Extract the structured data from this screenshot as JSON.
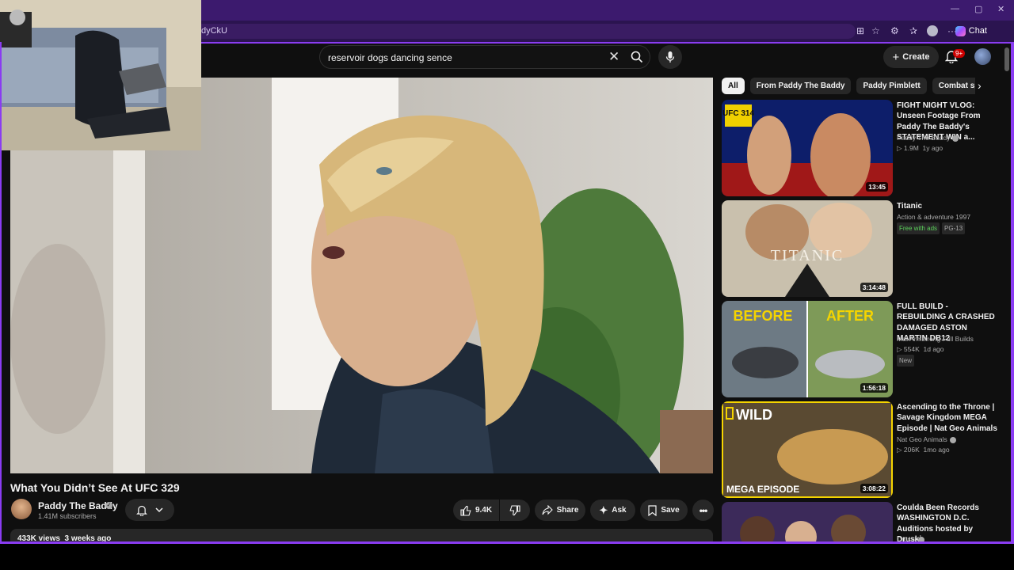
{
  "browser": {
    "url_fragment": "dyCkU",
    "chat_label": "Chat"
  },
  "search": {
    "query": "reservoir dogs dancing sence"
  },
  "header": {
    "create_label": "Create",
    "notif_badge": "9+"
  },
  "video": {
    "title": "What You Didn’t See At UFC 329",
    "channel": "Paddy The Baddy",
    "subscribers": "1.41M subscribers",
    "likes": "9.4K",
    "share_label": "Share",
    "ask_label": "Ask",
    "save_label": "Save",
    "views_date": "433K views  3 weeks ago"
  },
  "chips": [
    "All",
    "From Paddy The Baddy",
    "Paddy Pimblett",
    "Combat sports"
  ],
  "recs": [
    {
      "title": "FIGHT NIGHT VLOG: Unseen Footage From Paddy The Baddy's STATEMENT WIN a...",
      "channel": "Paddy The Baddy",
      "stats": "1.9M  1y ago",
      "duration": "13:45",
      "thumb_text": "UFC 314"
    },
    {
      "title": "Titanic",
      "sub": "Action & adventure 1997",
      "tag1": "Free with ads",
      "tag2": "PG-13",
      "duration": "3:14:48",
      "thumb_text": "TITANIC"
    },
    {
      "title": "FULL BUILD - REBUILDING A CRASHED DAMAGED ASTON MARTIN DB12",
      "channel": "Mat Armstrong Full Builds",
      "stats": "554K  1d ago",
      "tag1": "New",
      "duration": "1:56:18",
      "thumb_left": "BEFORE",
      "thumb_right": "AFTER"
    },
    {
      "title": "Ascending to the Throne | Savage Kingdom MEGA Episode | Nat Geo Animals",
      "channel": "Nat Geo Animals",
      "stats": "206K  1mo ago",
      "duration": "3:08:22",
      "thumb_top": "WILD",
      "thumb_bottom": "MEGA EPISODE"
    },
    {
      "title": "Coulda Been Records WASHINGTON D.C. Auditions hosted by Druski",
      "channel": "Druski"
    }
  ]
}
